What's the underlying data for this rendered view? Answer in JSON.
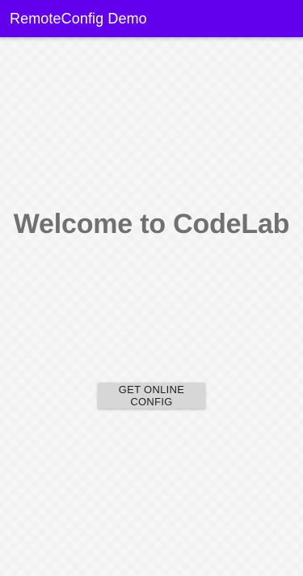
{
  "app_bar": {
    "title": "RemoteConfig Demo",
    "background": "#6200ee"
  },
  "main": {
    "welcome_text": "Welcome to CodeLab",
    "button_label": "GET ONLINE CONFIG"
  }
}
